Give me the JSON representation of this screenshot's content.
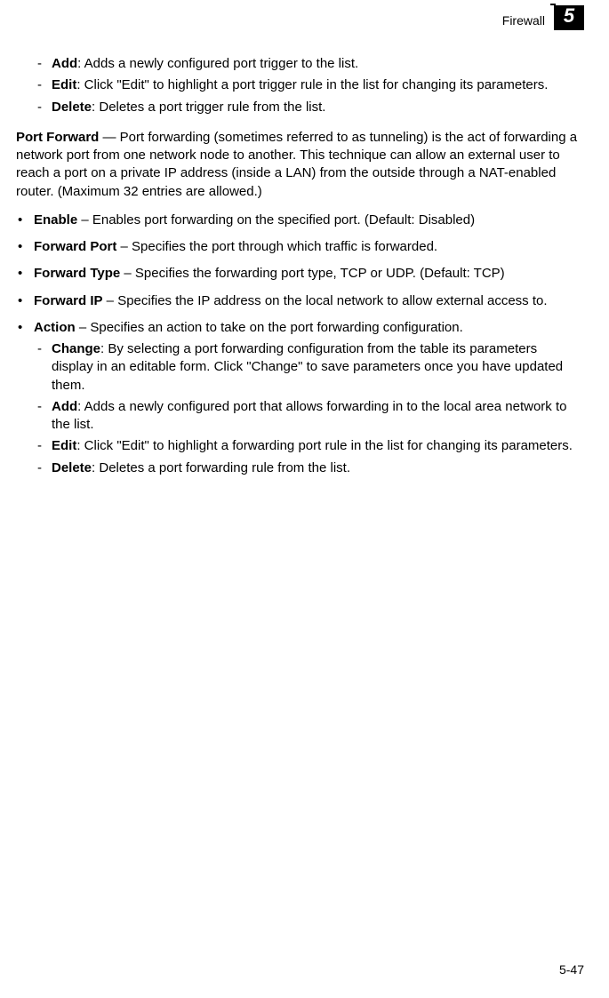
{
  "header": {
    "section": "Firewall",
    "chapter_number": "5"
  },
  "port_trigger_actions": [
    {
      "term": "Add",
      "desc": ": Adds a newly configured port trigger to the list."
    },
    {
      "term": "Edit",
      "desc": ": Click \"Edit\" to highlight a port trigger rule in the list for changing its parameters."
    },
    {
      "term": "Delete",
      "desc": ": Deletes a port trigger rule from the list."
    }
  ],
  "port_forward_heading": "Port Forward",
  "port_forward_intro": " — Port forwarding (sometimes referred to as tunneling) is the act of forwarding a network port from one network node to another. This technique can allow an external user to reach a port on a private IP address (inside a LAN) from the outside through a NAT-enabled router. (Maximum 32 entries are allowed.)",
  "port_forward_items": [
    {
      "term": "Enable",
      "desc": " – Enables port forwarding on the specified port. (Default: Disabled)"
    },
    {
      "term": "Forward Port",
      "desc": " – Specifies the port through which traffic is forwarded."
    },
    {
      "term": "Forward Type",
      "desc": " – Specifies the forwarding port type, TCP or UDP. (Default: TCP)"
    },
    {
      "term": "Forward IP",
      "desc": " – Specifies the IP address on the local network to allow external access to."
    }
  ],
  "action_item": {
    "term": "Action",
    "desc": " – Specifies an action to take on the port forwarding configuration.",
    "sub": [
      {
        "term": "Change",
        "desc": ": By selecting a port forwarding configuration from the table its parameters display in an editable form. Click \"Change\" to save parameters once you have updated them."
      },
      {
        "term": "Add",
        "desc": ": Adds a newly configured port that allows forwarding in to the local area network to the list."
      },
      {
        "term": "Edit",
        "desc": ": Click \"Edit\" to highlight a forwarding port rule in the list for changing its parameters."
      },
      {
        "term": "Delete",
        "desc": ": Deletes a port forwarding rule from the list."
      }
    ]
  },
  "footer": {
    "page_number": "5-47"
  }
}
